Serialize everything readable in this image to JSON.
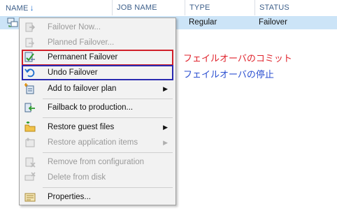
{
  "table": {
    "columns": [
      {
        "label": "NAME",
        "sort_icon": "sort-down-arrow-icon"
      },
      {
        "label": "JOB NAME"
      },
      {
        "label": "TYPE"
      },
      {
        "label": "STATUS"
      }
    ],
    "selected_row": {
      "type": "Regular",
      "status": "Failover",
      "icon": "vm-replica-icon"
    }
  },
  "context_menu": {
    "items": [
      {
        "label": "Failover Now...",
        "icon": "failover-now-icon",
        "enabled": false
      },
      {
        "label": "Planned Failover...",
        "icon": "planned-failover-icon",
        "enabled": false
      },
      {
        "label": "Permanent Failover",
        "icon": "permanent-failover-icon",
        "enabled": true
      },
      {
        "label": "Undo Failover",
        "icon": "undo-failover-icon",
        "enabled": true
      },
      {
        "label": "Add to failover plan",
        "icon": "add-to-plan-icon",
        "enabled": true,
        "submenu": true
      },
      {
        "label": "Failback to production...",
        "icon": "failback-icon",
        "enabled": true
      },
      {
        "label": "Restore guest files",
        "icon": "restore-files-icon",
        "enabled": true,
        "submenu": true
      },
      {
        "label": "Restore application items",
        "icon": "restore-app-items-icon",
        "enabled": false,
        "submenu": true
      },
      {
        "label": "Remove from configuration",
        "icon": "remove-config-icon",
        "enabled": false
      },
      {
        "label": "Delete from disk",
        "icon": "delete-disk-icon",
        "enabled": false
      },
      {
        "label": "Properties...",
        "icon": "properties-icon",
        "enabled": true
      }
    ],
    "submenu_glyph": "▶"
  },
  "annotations": {
    "permanent_failover_note": "フェイルオーバのコミット",
    "undo_failover_note": "フェイルオーバの停止",
    "colors": {
      "red": "#e0232c",
      "blue": "#2b4fd0"
    }
  }
}
